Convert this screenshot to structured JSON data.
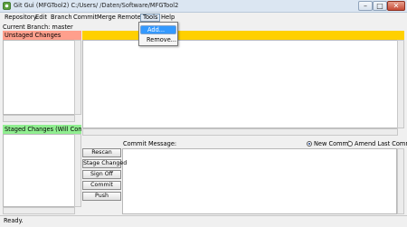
{
  "window": {
    "title": "Git Gui (MFGTool2) C:/Users/                    /Daten/Software/MFGTool2",
    "min_glyph": "–",
    "max_glyph": "□",
    "close_glyph": "✕"
  },
  "menubar": {
    "repository": "Repository",
    "edit": "Edit",
    "branch": "Branch",
    "commit": "Commit",
    "merge": "Merge",
    "remote": "Remote",
    "tools": "Tools",
    "help": "Help"
  },
  "tools_menu": {
    "add": "Add...",
    "remove": "Remove..."
  },
  "branch_line": "Current Branch: master",
  "unstaged": {
    "label": "Unstaged Changes"
  },
  "staged": {
    "label": "Staged Changes (Will Commit)"
  },
  "commit": {
    "message_label": "Commit Message:",
    "new_commit": "New Commit",
    "amend_last": "Amend Last Commit",
    "selected_option": "New Commit"
  },
  "buttons": {
    "rescan": "Rescan",
    "stage_changed": "Stage Changed",
    "sign_off": "Sign Off",
    "commit": "Commit",
    "push": "Push"
  },
  "status": "Ready.",
  "colors": {
    "unstaged_header": "#ff9f8c",
    "staged_header": "#90ee90",
    "diff_header": "#ffd000",
    "menu_highlight": "#3399ff"
  }
}
